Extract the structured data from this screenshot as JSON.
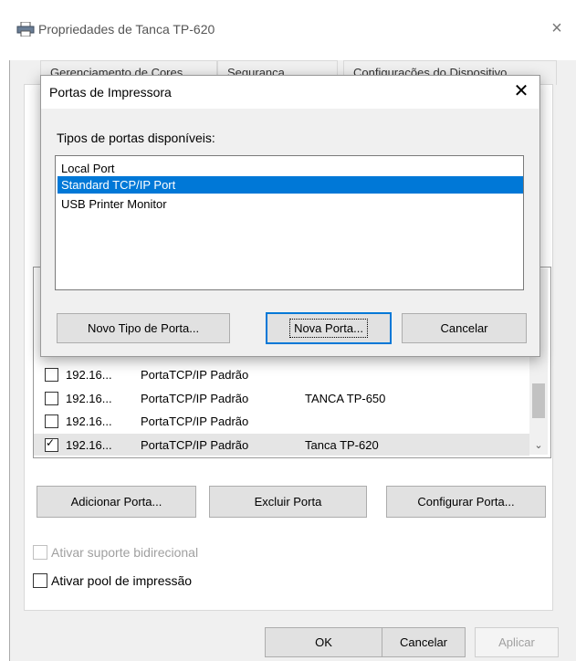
{
  "window": {
    "title": "Propriedades de Tanca TP-620",
    "close_glyph": "×",
    "icon": "printer-icon"
  },
  "tabs": [
    {
      "label": "Gerenciamento de Cores"
    },
    {
      "label": "Segurança"
    },
    {
      "label": "Configurações do Dispositivo"
    }
  ],
  "ports_list": {
    "rows": [
      {
        "checked": false,
        "port": "192.16...",
        "description": "PortaTCP/IP Padrão",
        "printer": ""
      },
      {
        "checked": false,
        "port": "192.16...",
        "description": "PortaTCP/IP Padrão",
        "printer": "TANCA TP-650"
      },
      {
        "checked": false,
        "port": "192.16...",
        "description": "PortaTCP/IP Padrão",
        "printer": ""
      },
      {
        "checked": true,
        "port": "192.16...",
        "description": "PortaTCP/IP Padrão",
        "printer": "Tanca TP-620"
      }
    ],
    "scroll_down_glyph": "⌄"
  },
  "port_buttons": {
    "add": "Adicionar Porta...",
    "delete": "Excluir Porta",
    "configure": "Configurar Porta..."
  },
  "options": {
    "bidirectional": "Ativar suporte bidirecional",
    "pooling": "Ativar pool de impressão"
  },
  "footer": {
    "ok": "OK",
    "cancel": "Cancelar",
    "apply": "Aplicar"
  },
  "dialog": {
    "title": "Portas de Impressora",
    "close_glyph": "✕",
    "types_label": "Tipos de portas disponíveis:",
    "port_types": [
      {
        "label": "Local Port",
        "selected": false
      },
      {
        "label": "Standard TCP/IP Port",
        "selected": true
      },
      {
        "label": "USB Printer Monitor",
        "selected": false
      }
    ],
    "new_type_button": "Novo Tipo de Porta...",
    "new_port_button": "Nova Porta...",
    "cancel_button": "Cancelar"
  },
  "colors": {
    "selection": "#0078d7",
    "window_bg": "#f0f0f0"
  }
}
